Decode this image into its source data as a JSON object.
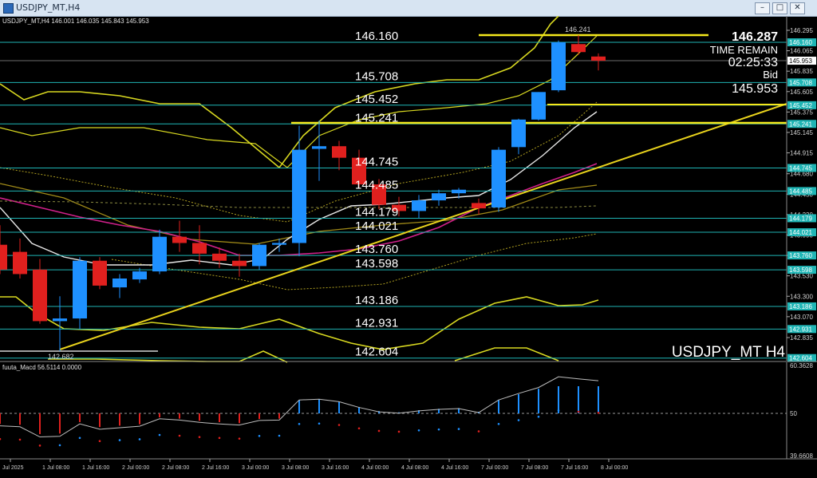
{
  "window": {
    "title": "USDJPY_MT,H4",
    "controls": [
      "–",
      "□",
      "✕"
    ]
  },
  "chart_header": {
    "symbol_line": "USDJPY_MT,H4  146.001 146.035 145.843 145.953"
  },
  "info_panel": {
    "price": "146.287",
    "time_remain_label": "TIME REMAIN",
    "time_remain": "02:25:33",
    "bid_label": "Bid",
    "bid": "145.953"
  },
  "watermark": "USDJPY_MT H4",
  "high_marker": "146.241",
  "low_marker": "142.682",
  "level_labels": [
    {
      "text": "146.160",
      "price": 146.16
    },
    {
      "text": "145.708",
      "price": 145.708
    },
    {
      "text": "145.452",
      "price": 145.452
    },
    {
      "text": "145.241",
      "price": 145.241
    },
    {
      "text": "144.745",
      "price": 144.745
    },
    {
      "text": "144.485",
      "price": 144.485
    },
    {
      "text": "144.179",
      "price": 144.179
    },
    {
      "text": "144.021",
      "price": 144.021
    },
    {
      "text": "143.760",
      "price": 143.76
    },
    {
      "text": "143.598",
      "price": 143.598
    },
    {
      "text": "143.186",
      "price": 143.186
    },
    {
      "text": "142.931",
      "price": 142.931
    },
    {
      "text": "142.604",
      "price": 142.604
    }
  ],
  "price_scale": [
    "146.295",
    "146.065",
    "145.835",
    "145.605",
    "145.375",
    "145.145",
    "144.915",
    "144.680",
    "144.450",
    "144.220",
    "143.990",
    "143.760",
    "143.530",
    "143.300",
    "143.070",
    "142.835"
  ],
  "price_tags": [
    "146.160",
    "145.953",
    "145.708",
    "145.452",
    "145.241",
    "144.745",
    "144.485",
    "144.179",
    "144.021",
    "143.760",
    "143.598",
    "143.186",
    "142.931",
    "142.604"
  ],
  "macd": {
    "label": "fuuta_Macd 56.5114  0.0000",
    "scale": [
      "60.3628",
      "50",
      "39.6608"
    ]
  },
  "time_axis": [
    "Jul 2025",
    "1 Jul 08:00",
    "1 Jul 16:00",
    "2 Jul 00:00",
    "2 Jul 08:00",
    "2 Jul 16:00",
    "3 Jul 00:00",
    "3 Jul 08:00",
    "3 Jul 16:00",
    "4 Jul 00:00",
    "4 Jul 08:00",
    "4 Jul 16:00",
    "7 Jul 00:00",
    "7 Jul 08:00",
    "7 Jul 16:00",
    "8 Jul 00:00"
  ],
  "chart_data": {
    "type": "candlestick",
    "candles": [
      {
        "o": 143.88,
        "h": 144.1,
        "l": 143.55,
        "c": 143.6
      },
      {
        "o": 143.8,
        "h": 143.95,
        "l": 143.5,
        "c": 143.55
      },
      {
        "o": 143.6,
        "h": 143.72,
        "l": 142.99,
        "c": 143.02
      },
      {
        "o": 143.02,
        "h": 143.3,
        "l": 142.682,
        "c": 143.05
      },
      {
        "o": 143.05,
        "h": 143.74,
        "l": 142.93,
        "c": 143.7
      },
      {
        "o": 143.7,
        "h": 143.74,
        "l": 143.38,
        "c": 143.42
      },
      {
        "o": 143.4,
        "h": 143.55,
        "l": 143.28,
        "c": 143.5
      },
      {
        "o": 143.49,
        "h": 143.62,
        "l": 143.45,
        "c": 143.58
      },
      {
        "o": 143.58,
        "h": 144.05,
        "l": 143.55,
        "c": 143.97
      },
      {
        "o": 143.97,
        "h": 144.15,
        "l": 143.8,
        "c": 143.9
      },
      {
        "o": 143.9,
        "h": 144.1,
        "l": 143.66,
        "c": 143.78
      },
      {
        "o": 143.78,
        "h": 143.85,
        "l": 143.62,
        "c": 143.7
      },
      {
        "o": 143.7,
        "h": 143.78,
        "l": 143.52,
        "c": 143.64
      },
      {
        "o": 143.64,
        "h": 143.9,
        "l": 143.6,
        "c": 143.88
      },
      {
        "o": 143.88,
        "h": 143.95,
        "l": 143.8,
        "c": 143.9
      },
      {
        "o": 143.9,
        "h": 145.22,
        "l": 143.75,
        "c": 144.95
      },
      {
        "o": 144.96,
        "h": 145.28,
        "l": 144.6,
        "c": 144.99
      },
      {
        "o": 144.99,
        "h": 145.05,
        "l": 144.72,
        "c": 144.86
      },
      {
        "o": 144.86,
        "h": 144.95,
        "l": 144.52,
        "c": 144.56
      },
      {
        "o": 144.56,
        "h": 144.62,
        "l": 144.28,
        "c": 144.33
      },
      {
        "o": 144.33,
        "h": 144.42,
        "l": 144.2,
        "c": 144.26
      },
      {
        "o": 144.26,
        "h": 144.44,
        "l": 144.18,
        "c": 144.38
      },
      {
        "o": 144.38,
        "h": 144.5,
        "l": 144.32,
        "c": 144.46
      },
      {
        "o": 144.46,
        "h": 144.52,
        "l": 144.4,
        "c": 144.5
      },
      {
        "o": 144.35,
        "h": 144.4,
        "l": 144.22,
        "c": 144.29
      },
      {
        "o": 144.3,
        "h": 144.98,
        "l": 144.25,
        "c": 144.95
      },
      {
        "o": 144.98,
        "h": 145.3,
        "l": 144.9,
        "c": 145.29
      },
      {
        "o": 145.29,
        "h": 145.6,
        "l": 145.28,
        "c": 145.6
      },
      {
        "o": 145.62,
        "h": 146.18,
        "l": 145.6,
        "c": 146.16
      },
      {
        "o": 146.14,
        "h": 146.241,
        "l": 146.02,
        "c": 146.05
      },
      {
        "o": 146.0,
        "h": 146.035,
        "l": 145.843,
        "c": 145.953
      }
    ]
  },
  "colors": {
    "bull": "#1e90ff",
    "bear": "#e0201e",
    "level_line": "#1fb5b5",
    "trend": "#e8d21c",
    "band": "#d8d820",
    "ma_pink": "#d0208a",
    "ma_white": "#e0e0e0"
  }
}
